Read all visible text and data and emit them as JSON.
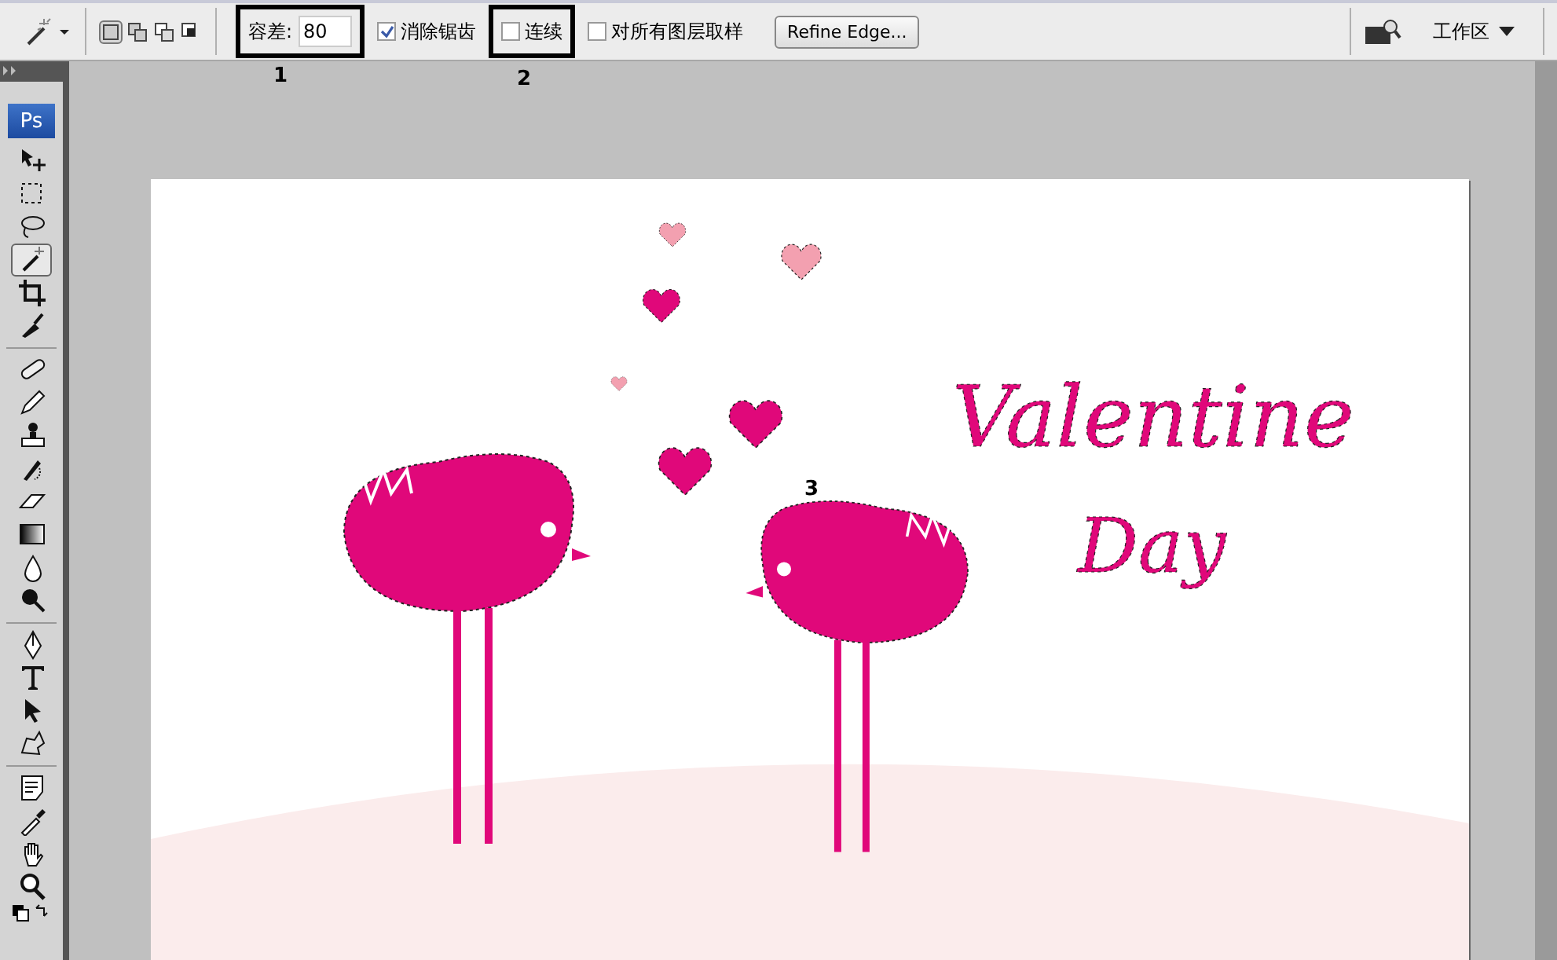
{
  "options_bar": {
    "selection_modes": [
      {
        "selected": true
      },
      {
        "selected": false
      },
      {
        "selected": false
      },
      {
        "selected": false
      }
    ],
    "tolerance": {
      "label": "容差:",
      "value": "80",
      "highlighted": true
    },
    "checkboxes": [
      {
        "label": "消除锯齿",
        "checked": true,
        "highlighted": false
      },
      {
        "label": "连续",
        "checked": false,
        "highlighted": true
      },
      {
        "label": "对所有图层取样",
        "checked": false,
        "highlighted": false
      }
    ],
    "refine_button": "Refine Edge...",
    "workspace": "工作区"
  },
  "toolbox": {
    "logo": "Ps",
    "tools": [
      {
        "kind": "move",
        "selected": false
      },
      {
        "kind": "marquee",
        "selected": false
      },
      {
        "kind": "lasso",
        "selected": false
      },
      {
        "kind": "wand",
        "selected": true
      },
      {
        "kind": "crop",
        "selected": false
      },
      {
        "kind": "slice",
        "selected": false
      },
      {
        "kind": "sep"
      },
      {
        "kind": "bandage",
        "selected": false
      },
      {
        "kind": "brush",
        "selected": false
      },
      {
        "kind": "stamp",
        "selected": false
      },
      {
        "kind": "history",
        "selected": false
      },
      {
        "kind": "eraser",
        "selected": false
      },
      {
        "kind": "gradient",
        "selected": false
      },
      {
        "kind": "drop",
        "selected": false
      },
      {
        "kind": "dodge",
        "selected": false
      },
      {
        "kind": "sep"
      },
      {
        "kind": "pen",
        "selected": false
      },
      {
        "kind": "type",
        "selected": false
      },
      {
        "kind": "pointer",
        "selected": false
      },
      {
        "kind": "shape",
        "selected": false
      },
      {
        "kind": "sep"
      },
      {
        "kind": "note",
        "selected": false
      },
      {
        "kind": "eyedropper",
        "selected": false
      },
      {
        "kind": "hand",
        "selected": false
      },
      {
        "kind": "zoom",
        "selected": false
      }
    ]
  },
  "annotations": [
    "1",
    "2",
    "3"
  ],
  "document": {
    "art_text": [
      "Valentine",
      "Day"
    ]
  }
}
